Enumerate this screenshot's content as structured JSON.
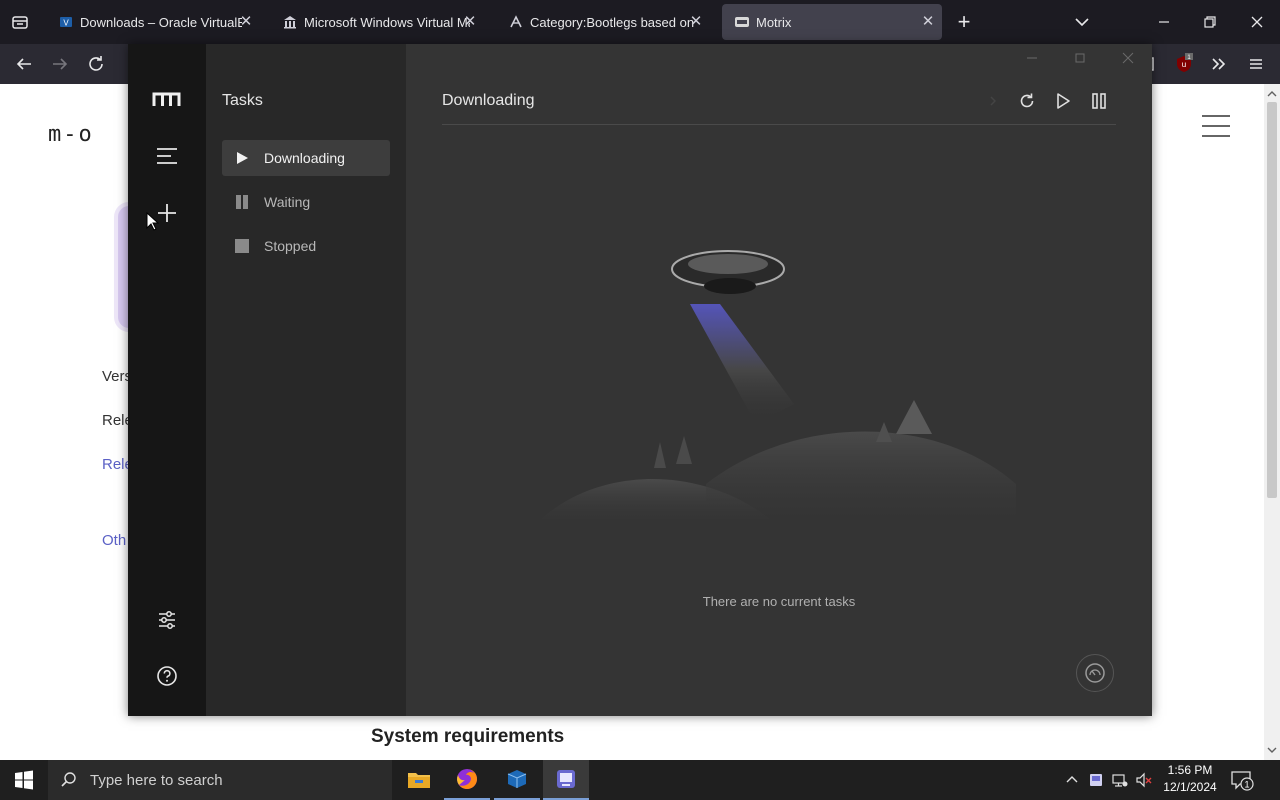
{
  "browser": {
    "tabs": [
      {
        "label": "Downloads – Oracle VirtualBox",
        "icon": "virtualbox-icon",
        "active": false
      },
      {
        "label": "Microsoft Windows Virtual Mac",
        "icon": "museum-icon",
        "active": false
      },
      {
        "label": "Category:Bootlegs based on Wi",
        "icon": "wiki-icon",
        "active": false
      },
      {
        "label": "Motrix",
        "icon": "motrix-tab-icon",
        "active": true
      }
    ],
    "close_glyph": "✕",
    "new_tab_glyph": "+"
  },
  "webpage": {
    "logo": "m-o",
    "lines": [
      "Vers",
      "Rele",
      "Rele",
      "Oth"
    ],
    "section_heading": "System requirements"
  },
  "motrix": {
    "sidebar_title": "Tasks",
    "menu": [
      {
        "label": "Downloading",
        "icon": "play-icon",
        "active": true
      },
      {
        "label": "Waiting",
        "icon": "pause-icon",
        "active": false
      },
      {
        "label": "Stopped",
        "icon": "stop-icon",
        "active": false
      }
    ],
    "main_title": "Downloading",
    "empty_message": "There are no current tasks"
  },
  "taskbar": {
    "search_placeholder": "Type here to search",
    "time": "1:56 PM",
    "date": "12/1/2024",
    "notification_count": "1"
  },
  "colors": {
    "browser_tabstrip": "#1c1b22",
    "browser_navbar": "#2b2a33",
    "motrix_rail": "#161616",
    "motrix_sidebar": "#282828",
    "motrix_main": "#343434",
    "link": "#5b61c6",
    "ufo_beam": "#5a5ad0"
  }
}
